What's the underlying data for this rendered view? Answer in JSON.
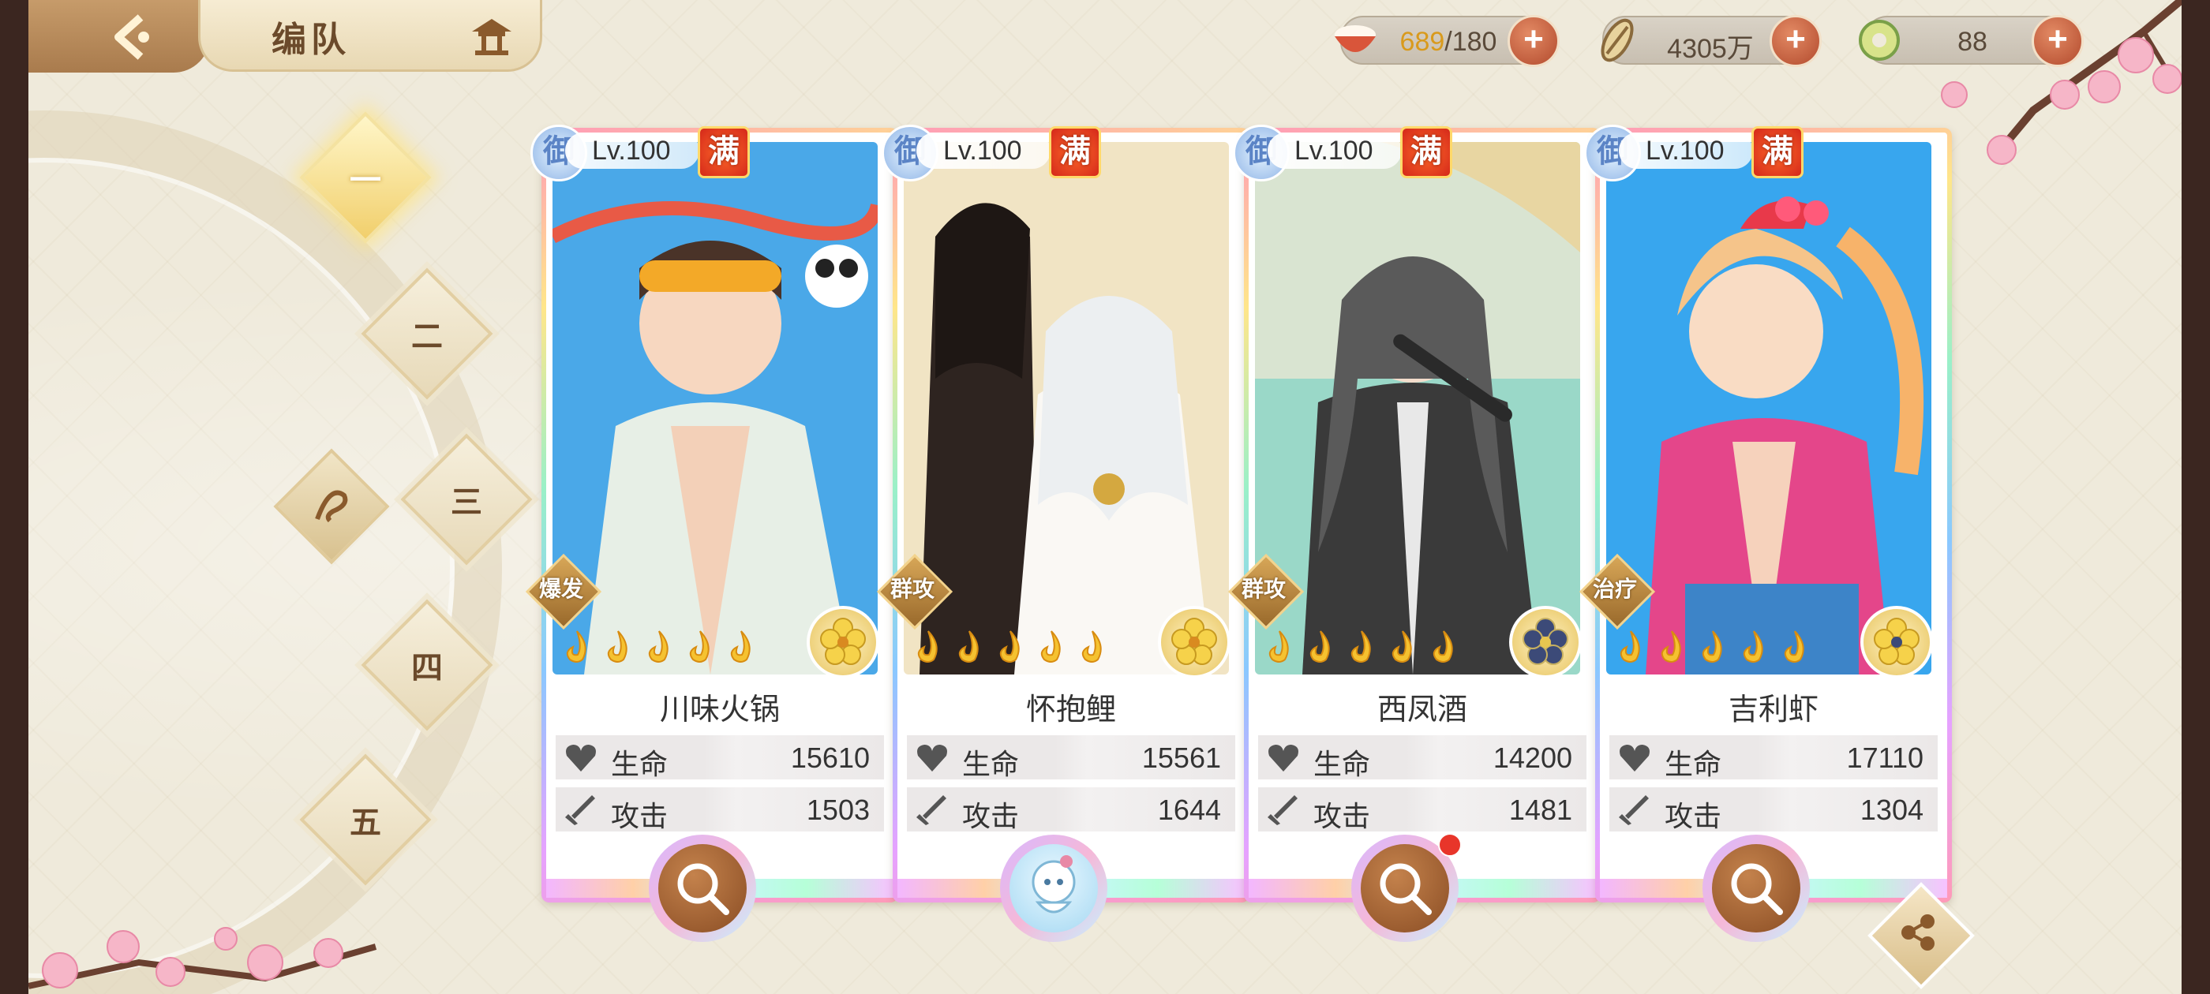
{
  "header": {
    "title": "编队"
  },
  "resources": [
    {
      "name": "bowl",
      "current": "689",
      "max": "/180",
      "icon": "rice-bowl-icon"
    },
    {
      "name": "coins",
      "value": "4305万",
      "icon": "coin-icon"
    },
    {
      "name": "gems",
      "value": "88",
      "icon": "jade-icon"
    }
  ],
  "teams": [
    "一",
    "二",
    "三",
    "四",
    "五"
  ],
  "team_active": "一",
  "stat_labels": {
    "hp": "生命",
    "atk": "攻击"
  },
  "cards": [
    {
      "badge": "御",
      "level": "Lv.100",
      "max_badge": "满",
      "role": "爆发",
      "name": "川味火锅",
      "hp": "15610",
      "atk": "1503",
      "stars": 5,
      "element": "flower-icon",
      "bg": "#4aa8e8",
      "equip": "magnifier-icon",
      "notify": false
    },
    {
      "badge": "御",
      "level": "Lv.100",
      "max_badge": "满",
      "role": "群攻",
      "name": "怀抱鲤",
      "hp": "15561",
      "atk": "1644",
      "stars": 5,
      "element": "flower-icon",
      "bg": "#f1e4c4",
      "equip": "pet-icon",
      "notify": false
    },
    {
      "badge": "御",
      "level": "Lv.100",
      "max_badge": "满",
      "role": "群攻",
      "name": "西凤酒",
      "hp": "14200",
      "atk": "1481",
      "stars": 5,
      "element": "flower-icon",
      "bg": "#9ad8c8",
      "equip": "magnifier-icon",
      "notify": true
    },
    {
      "badge": "御",
      "level": "Lv.100",
      "max_badge": "满",
      "role": "治疗",
      "name": "吉利虾",
      "hp": "17110",
      "atk": "1304",
      "stars": 5,
      "element": "flower-icon",
      "bg": "#38a6ee",
      "equip": "magnifier-icon",
      "notify": false
    }
  ],
  "colors": {
    "accent": "#d99a1c",
    "background": "#efeadb",
    "plus_button": "#c0553a"
  }
}
